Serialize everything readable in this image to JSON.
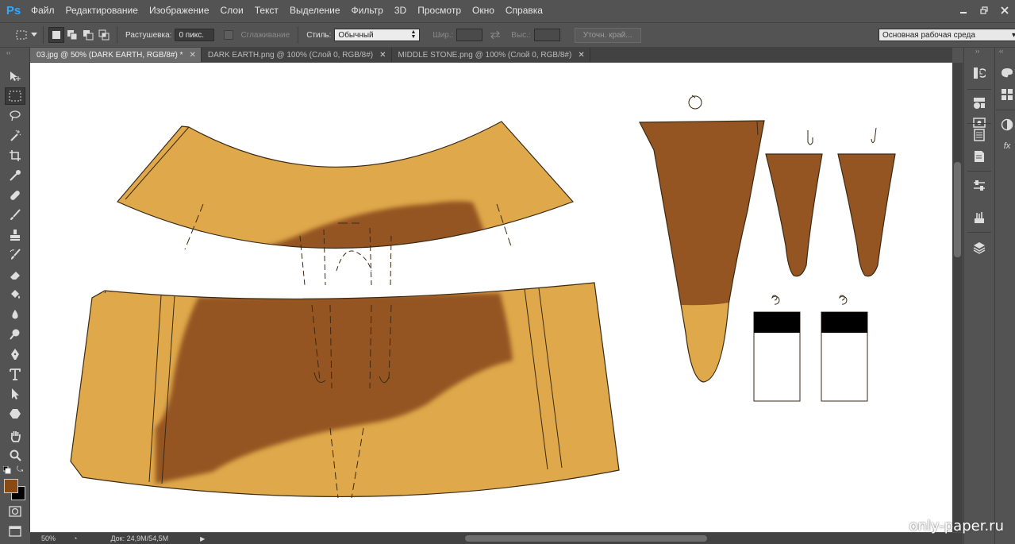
{
  "app": {
    "logo": "Ps",
    "menu": [
      "Файл",
      "Редактирование",
      "Изображение",
      "Слои",
      "Текст",
      "Выделение",
      "Фильтр",
      "3D",
      "Просмотр",
      "Окно",
      "Справка"
    ]
  },
  "options": {
    "feather_label": "Растушевка:",
    "feather_value": "0 пикс.",
    "antialias_label": "Сглаживание",
    "style_label": "Стиль:",
    "style_value": "Обычный",
    "width_label": "Шир.:",
    "height_label": "Выс.:",
    "refine_edge": "Уточн. край...",
    "workspace": "Основная рабочая среда"
  },
  "tabs": [
    {
      "label": "03.jpg @ 50% (DARK EARTH, RGB/8#) *",
      "active": true
    },
    {
      "label": "DARK EARTH.png @ 100% (Слой 0, RGB/8#)",
      "active": false
    },
    {
      "label": "MIDDLE STONE.png @ 100% (Слой 0, RGB/8#)",
      "active": false
    }
  ],
  "status": {
    "zoom": "50%",
    "doc_info": "Док: 24,9M/54,5M"
  },
  "colors": {
    "foreground": "#8a4a14",
    "background": "#000000",
    "tan": "#dfa84a",
    "brown": "#955523"
  },
  "icons": {
    "tools": [
      "move-icon",
      "marquee-icon",
      "lasso-icon",
      "magic-wand-icon",
      "crop-icon",
      "eyedropper-icon",
      "healing-brush-icon",
      "brush-icon",
      "clone-stamp-icon",
      "history-brush-icon",
      "eraser-icon",
      "paint-bucket-icon",
      "blur-icon",
      "dodge-icon",
      "pen-icon",
      "type-icon",
      "path-selection-icon",
      "shape-icon",
      "hand-icon",
      "zoom-icon"
    ]
  },
  "watermark": "only-paper.ru"
}
